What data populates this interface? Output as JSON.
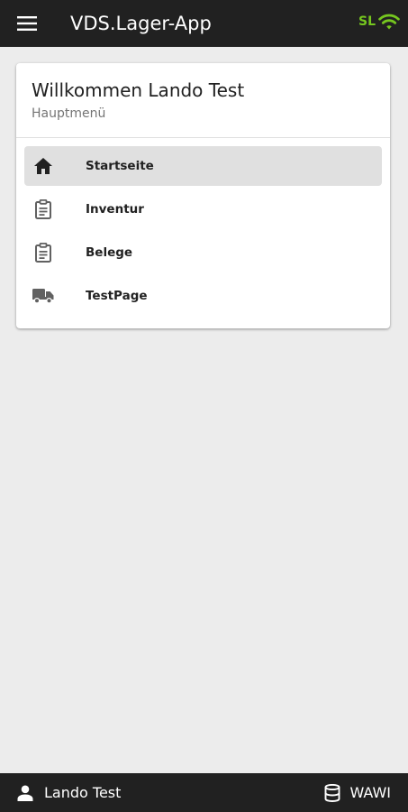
{
  "appbar": {
    "title": "VDS.Lager-App",
    "menu_icon": "menu-icon",
    "status_label": "SL",
    "status_icon": "wifi-icon",
    "status_color": "#76c71f"
  },
  "card": {
    "title": "Willkommen Lando Test",
    "subtitle": "Hauptmenü"
  },
  "nav": {
    "items": [
      {
        "label": "Startseite",
        "icon": "home-icon",
        "active": true
      },
      {
        "label": "Inventur",
        "icon": "clipboard-icon",
        "active": false
      },
      {
        "label": "Belege",
        "icon": "clipboard-icon",
        "active": false
      },
      {
        "label": "TestPage",
        "icon": "truck-icon",
        "active": false
      }
    ]
  },
  "footer": {
    "user_name": "Lando Test",
    "user_icon": "person-icon",
    "db_name": "WAWI",
    "db_icon": "database-icon"
  }
}
